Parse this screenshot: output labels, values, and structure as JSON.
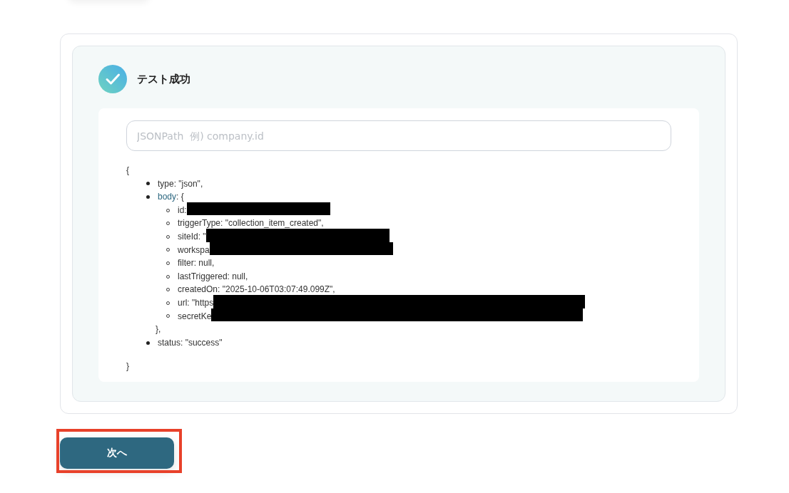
{
  "result": {
    "title": "テスト成功"
  },
  "search": {
    "placeholder": "JSONPath  例) company.id"
  },
  "output": {
    "open": "{",
    "items": [
      {
        "text": "type: \"json\","
      },
      {
        "key": "body",
        "text": ": {",
        "close": "},",
        "children": [
          {
            "text": "id:",
            "redacted": true
          },
          {
            "text": "triggerType: \"collection_item_created\",",
            "redacted": false
          },
          {
            "text": "siteId: \"",
            "redacted": true
          },
          {
            "text": "workspa",
            "redacted": true
          },
          {
            "text": "filter: null,",
            "redacted": false
          },
          {
            "text": "lastTriggered: null,",
            "redacted": false
          },
          {
            "text": "createdOn: \"2025-10-06T03:07:49.099Z\",",
            "redacted": false
          },
          {
            "text": "url: \"https",
            "redacted": true
          },
          {
            "text": "secretKe",
            "redacted": true
          }
        ]
      },
      {
        "text": "status: \"success\""
      }
    ],
    "close": "}"
  },
  "next_button": {
    "label": "次へ",
    "highlighted": true
  }
}
